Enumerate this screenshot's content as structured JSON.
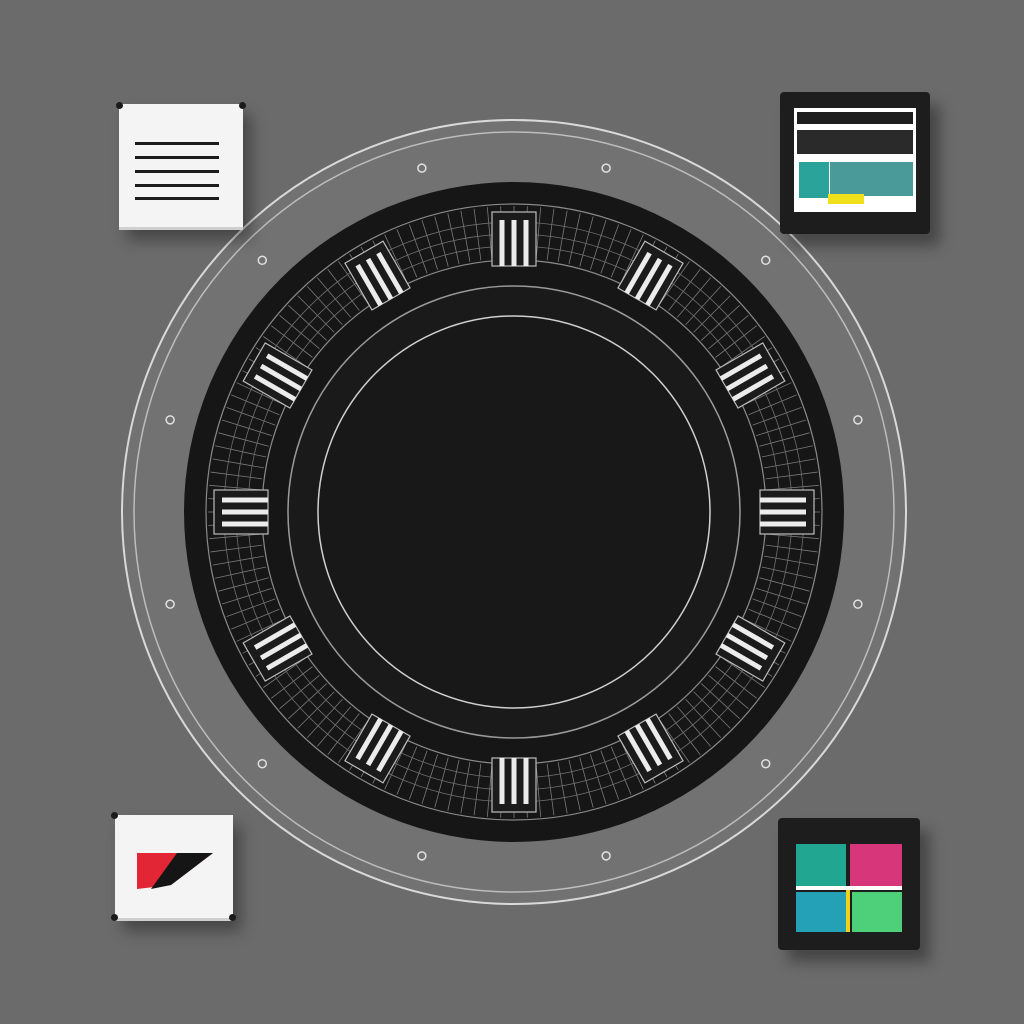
{
  "colors": {
    "background": "#6b6b6b",
    "dial": "#151515",
    "ring_outline": "#d8d8d8",
    "card_light": "#f4f4f4",
    "card_dark": "#1d1d1d",
    "flag_red": "#e22636",
    "flag_black": "#151515",
    "grid_teal": "#21a691",
    "grid_magenta": "#d8367a",
    "grid_cyan": "#24a0b7",
    "grid_green": "#4ed07a",
    "grid_yellow": "#f0d21c",
    "window_panel": "#4a9a9a"
  },
  "icons": {
    "document": "document-icon",
    "window": "window-icon",
    "flag": "flag-icon",
    "grid": "color-grid-icon",
    "dial": "circular-dial"
  }
}
